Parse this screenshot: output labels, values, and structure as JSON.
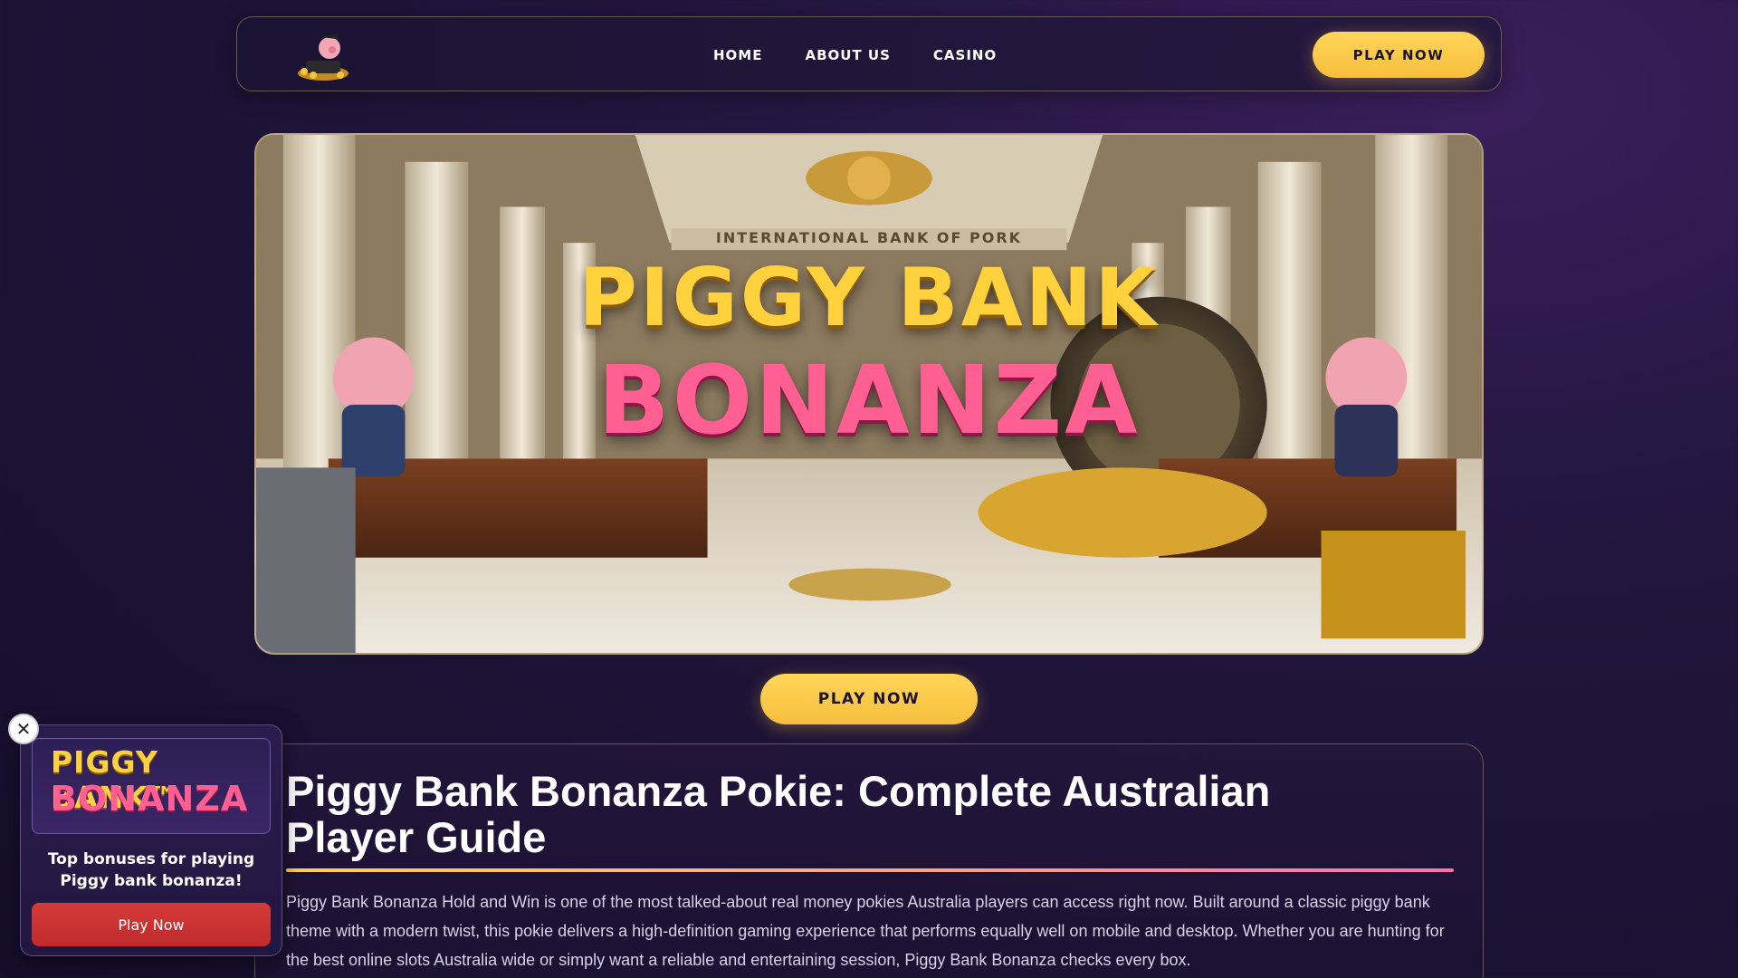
{
  "header": {
    "logo_icon": "piggy-logo-icon",
    "nav": [
      {
        "label": "HOME"
      },
      {
        "label": "ABOUT US"
      },
      {
        "label": "CASINO"
      }
    ],
    "cta_label": "PLAY NOW"
  },
  "hero": {
    "bank_sign": "INTERNATIONAL BANK OF PORK",
    "title_line1": "PIGGY BANK",
    "title_line2": "BONANZA"
  },
  "play_center_label": "PLAY NOW",
  "article": {
    "heading": "Piggy Bank Bonanza Pokie: Complete Australian Player Guide",
    "intro": "Piggy Bank Bonanza Hold and Win is one of the most talked-about real money pokies Australia players can access right now. Built around a classic piggy bank theme with a modern twist, this pokie delivers a high-definition gaming experience that performs equally well on mobile and desktop. Whether you are hunting for the best online slots Australia wide or simply want a reliable and entertaining session, Piggy Bank Bonanza checks every box."
  },
  "popup": {
    "logo_line1": "PIGGY BANK™",
    "logo_line2": "BONANZA",
    "text": "Top bonuses for playing Piggy bank bonanza!",
    "button_label": "Play Now",
    "close_icon": "close-icon",
    "close_glyph": "✕"
  },
  "colors": {
    "gold": "#f7be3c",
    "pink": "#ff5f92",
    "red": "#d63a3a",
    "bg": "#1a1233"
  }
}
